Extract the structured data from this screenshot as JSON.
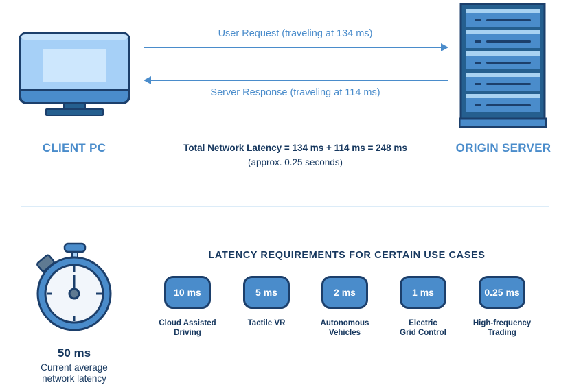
{
  "top": {
    "client_label": "CLIENT PC",
    "server_label": "ORIGIN SERVER",
    "request_label": "User Request (traveling at 134 ms)",
    "response_label": "Server Response (traveling at 114 ms)",
    "total_line": "Total Network Latency = 134 ms + 114 ms = 248 ms",
    "total_sub": "(approx. 0.25 seconds)"
  },
  "bottom": {
    "current_value": "50 ms",
    "current_desc_line1": "Current average",
    "current_desc_line2": "network latency",
    "requirements_title": "LATENCY REQUIREMENTS FOR CERTAIN USE CASES",
    "use_cases": [
      {
        "value": "10 ms",
        "line1": "Cloud Assisted",
        "line2": "Driving"
      },
      {
        "value": "5 ms",
        "line1": "Tactile VR",
        "line2": ""
      },
      {
        "value": "2 ms",
        "line1": "Autonomous",
        "line2": "Vehicles"
      },
      {
        "value": "1 ms",
        "line1": "Electric",
        "line2": "Grid Control"
      },
      {
        "value": "0.25 ms",
        "line1": "High-frequency",
        "line2": "Trading"
      }
    ]
  },
  "icons": {
    "client": "desktop-monitor-icon",
    "server": "server-rack-icon",
    "timer": "stopwatch-icon"
  },
  "colors": {
    "accent": "#4a8ccb",
    "navy": "#17385f",
    "light_blue": "#a6d0f7",
    "divider": "#dcecf8"
  }
}
